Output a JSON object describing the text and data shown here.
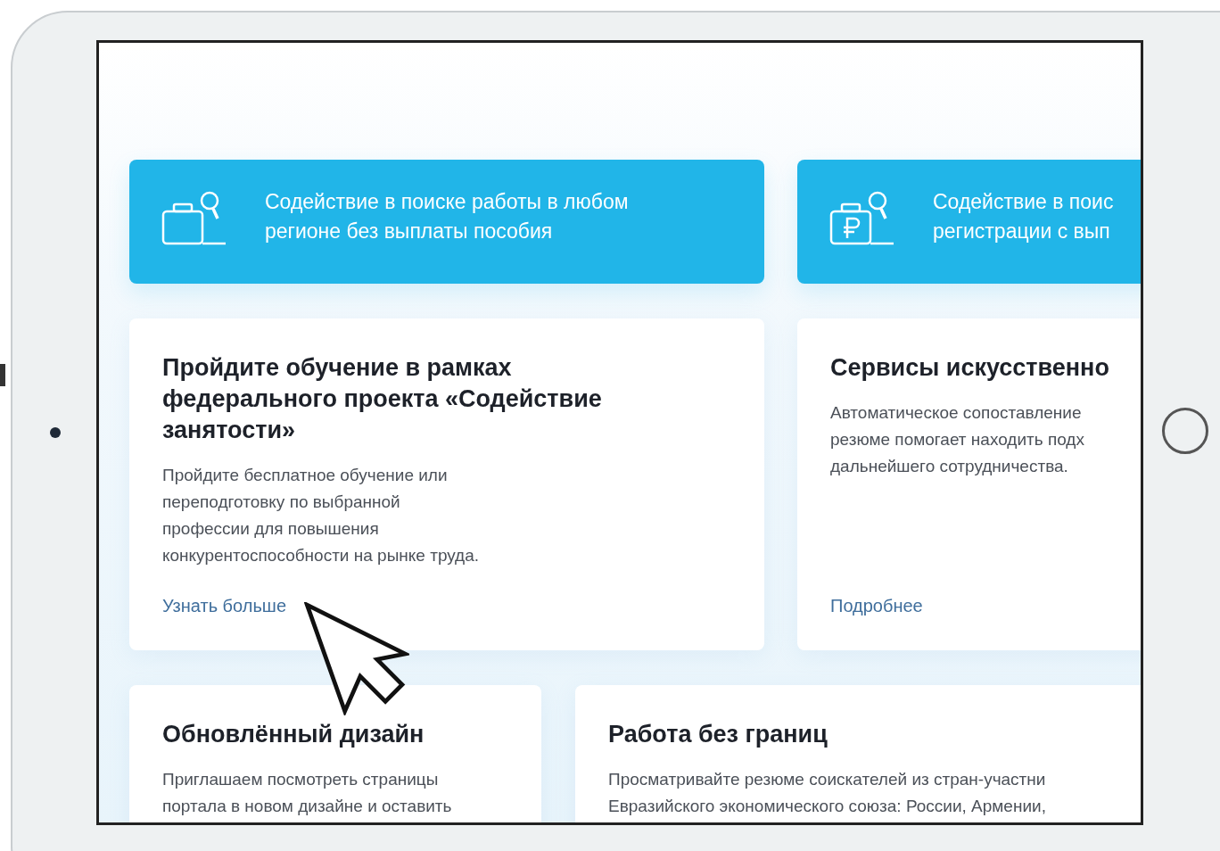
{
  "service_cards": [
    {
      "kind": "briefcase",
      "lines": [
        "Содействие в поиске работы в любом",
        "регионе без выплаты пособия"
      ]
    },
    {
      "kind": "ruble",
      "lines": [
        "Содействие в поис",
        "регистрации с вып"
      ]
    }
  ],
  "info_cards": [
    {
      "title_lines": [
        "Пройдите обучение в рамках",
        "федерального проекта «Содействие",
        "занятости»"
      ],
      "body_lines": [
        "Пройдите бесплатное обучение или",
        "переподготовку по выбранной",
        "профессии для повышения",
        "конкурентоспособности на рынке труда."
      ],
      "link": "Узнать больше"
    },
    {
      "title_lines": [
        "Сервисы искусственно"
      ],
      "body_lines": [
        "Автоматическое сопоставление",
        "резюме помогает находить подх",
        "дальнейшего сотрудничества."
      ],
      "link": "Подробнее"
    }
  ],
  "bottom_cards": [
    {
      "title": "Обновлённый дизайн",
      "body_lines": [
        "Приглашаем посмотреть страницы",
        "портала в новом дизайне и оставить"
      ]
    },
    {
      "title": "Работа без границ",
      "body_lines": [
        "Просматривайте резюме соискателей из стран-участни",
        "Евразийского экономического союза: России, Армении,"
      ]
    }
  ]
}
